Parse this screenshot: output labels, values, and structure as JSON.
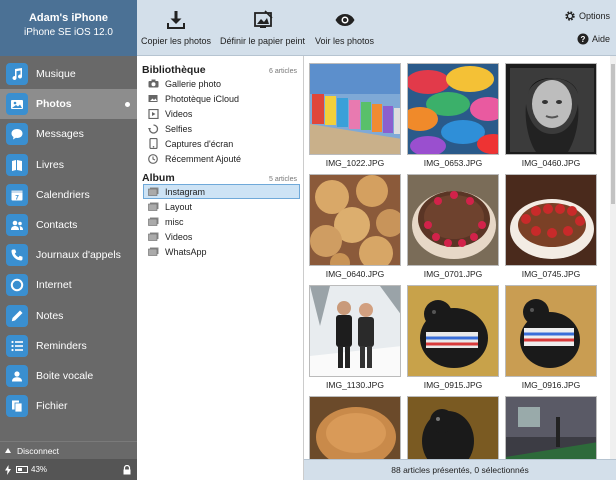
{
  "device": {
    "name": "Adam's iPhone",
    "model": "iPhone SE iOS 12.0"
  },
  "sidebar": {
    "items": [
      {
        "label": "Musique",
        "icon": "music-note-icon"
      },
      {
        "label": "Photos",
        "icon": "photos-icon",
        "active": true
      },
      {
        "label": "Messages",
        "icon": "speech-bubble-icon"
      },
      {
        "label": "Livres",
        "icon": "books-icon"
      },
      {
        "label": "Calendriers",
        "icon": "calendar-icon"
      },
      {
        "label": "Contacts",
        "icon": "contacts-icon"
      },
      {
        "label": "Journaux d'appels",
        "icon": "phone-icon"
      },
      {
        "label": "Internet",
        "icon": "globe-icon"
      },
      {
        "label": "Notes",
        "icon": "pencil-icon"
      },
      {
        "label": "Reminders",
        "icon": "list-icon"
      },
      {
        "label": "Boite vocale",
        "icon": "voicemail-icon"
      },
      {
        "label": "Fichier",
        "icon": "file-icon"
      }
    ],
    "disconnect_label": "Disconnect",
    "battery_percent": "43%",
    "battery_level": 0.43
  },
  "toolbar": {
    "copy_label": "Copier les photos",
    "wallpaper_label": "Définir le papier peint",
    "view_label": "Voir les photos",
    "options_label": "Options",
    "help_label": "Aide"
  },
  "library": {
    "title": "Bibliothèque",
    "count": "6 articles",
    "items": [
      {
        "label": "Gallerie photo",
        "icon": "camera-icon"
      },
      {
        "label": "Phototèque iCloud",
        "icon": "cloud-icon"
      },
      {
        "label": "Videos",
        "icon": "video-icon"
      },
      {
        "label": "Selfies",
        "icon": "selfie-icon"
      },
      {
        "label": "Captures d'écran",
        "icon": "screenshot-icon"
      },
      {
        "label": "Récemment Ajouté",
        "icon": "clock-icon"
      }
    ]
  },
  "album": {
    "title": "Album",
    "count": "5 articles",
    "items": [
      {
        "label": "Instagram",
        "selected": true
      },
      {
        "label": "Layout"
      },
      {
        "label": "misc"
      },
      {
        "label": "Videos"
      },
      {
        "label": "WhatsApp"
      }
    ]
  },
  "photos": [
    {
      "name": "IMG_1022.JPG",
      "subject": "beach-huts"
    },
    {
      "name": "IMG_0653.JPG",
      "subject": "umbrellas"
    },
    {
      "name": "IMG_0460.JPG",
      "subject": "portrait"
    },
    {
      "name": "IMG_0640.JPG",
      "subject": "cookies"
    },
    {
      "name": "IMG_0701.JPG",
      "subject": "cake"
    },
    {
      "name": "IMG_0745.JPG",
      "subject": "dessert"
    },
    {
      "name": "IMG_1130.JPG",
      "subject": "couple-snow"
    },
    {
      "name": "IMG_0915.JPG",
      "subject": "dog-sweater"
    },
    {
      "name": "IMG_0916.JPG",
      "subject": "dog-sweater-2"
    },
    {
      "name": "",
      "subject": "bread"
    },
    {
      "name": "",
      "subject": "dog-dark"
    },
    {
      "name": "",
      "subject": "pool-room"
    }
  ],
  "footer": {
    "status": "88 articles présentés, 0 sélectionnés"
  }
}
